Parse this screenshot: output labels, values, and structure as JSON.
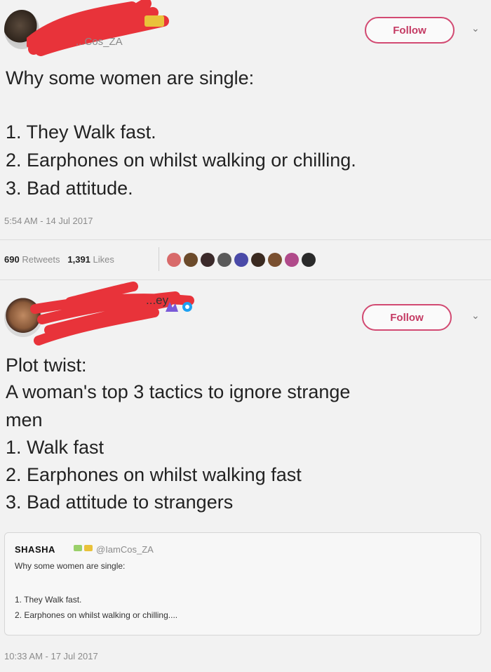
{
  "tweet1": {
    "handle": "...Cos_ZA",
    "follow_label": "Follow",
    "chevron": "⌄",
    "lines": [
      "Why some women are single:",
      "1. They Walk fast.",
      "2. Earphones on whilst walking or chilling.",
      "3. Bad attitude."
    ],
    "timestamp": "5:54 AM - 14 Jul 2017",
    "retweets_count": "690",
    "retweets_label": "Retweets",
    "likes_count": "1,391",
    "likes_label": "Likes",
    "liker_colors": [
      "#d86a6a",
      "#6b4a2a",
      "#3b2a2a",
      "#5a5a5a",
      "#4a4aa8",
      "#3a2a20",
      "#7a5030",
      "#b04a8a",
      "#2a2a2a"
    ]
  },
  "tweet2": {
    "handle": "...ey",
    "follow_label": "Follow",
    "chevron": "⌄",
    "lines": [
      "Plot twist:",
      "A woman's top 3 tactics to ignore strange",
      "men",
      "1. Walk fast",
      "2. Earphones on whilst walking fast",
      "3. Bad attitude to strangers"
    ],
    "quote": {
      "name": "SHASHA",
      "handle": "@IamCos_ZA",
      "lines": [
        "Why some women are single:",
        "1. They Walk fast.",
        "2. Earphones on whilst walking or chilling...."
      ]
    },
    "timestamp": "10:33 AM - 17 Jul 2017"
  },
  "colors": {
    "accent": "#c43a63",
    "redaction": "#e8333a",
    "verified": "#1da1f2"
  },
  "icons": {
    "tweet1_avatar": "avatar",
    "tweet2_avatar": "avatar",
    "verified": "verified-badge-icon",
    "chevron": "chevron-down-icon"
  }
}
